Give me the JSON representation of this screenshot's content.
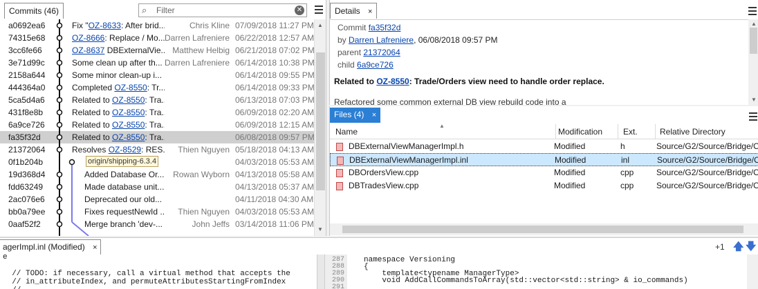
{
  "commits_panel": {
    "tab_label": "Commits (46)",
    "filter_placeholder": "Filter",
    "rows": [
      {
        "hash": "a0692ea6",
        "msg_pre": "Fix \"",
        "msg_link": "OZ-8633",
        "msg_post": ": After brid...",
        "author": "Chris Kline",
        "date": "07/09/2018 11:27 PM"
      },
      {
        "hash": "74315e68",
        "msg_pre": "",
        "msg_link": "OZ-8666",
        "msg_post": ": Replace / Mo...",
        "author": "Darren Lafreniere",
        "date": "06/22/2018 12:57 AM"
      },
      {
        "hash": "3cc6fe66",
        "msg_pre": "",
        "msg_link": "OZ-8637",
        "msg_post": " DBExternalVie...",
        "author": "Matthew Helbig",
        "date": "06/21/2018 07:02 PM"
      },
      {
        "hash": "3e71d99c",
        "msg_pre": "Some clean up after th...",
        "msg_link": "",
        "msg_post": "",
        "author": "Darren Lafreniere",
        "date": "06/14/2018 10:38 PM"
      },
      {
        "hash": "2158a644",
        "msg_pre": "Some minor clean-up i...",
        "msg_link": "",
        "msg_post": "",
        "author": "",
        "date": "06/14/2018 09:55 PM"
      },
      {
        "hash": "444364a0",
        "msg_pre": "Completed ",
        "msg_link": "OZ-8550",
        "msg_post": ": Tr...",
        "author": "",
        "date": "06/14/2018 09:33 PM"
      },
      {
        "hash": "5ca5d4a6",
        "msg_pre": "Related to ",
        "msg_link": "OZ-8550",
        "msg_post": ": Tra...",
        "author": "",
        "date": "06/13/2018 07:03 PM"
      },
      {
        "hash": "431f8e8b",
        "msg_pre": "Related to ",
        "msg_link": "OZ-8550",
        "msg_post": ": Tra...",
        "author": "",
        "date": "06/09/2018 02:20 AM"
      },
      {
        "hash": "6a9ce726",
        "msg_pre": "Related to ",
        "msg_link": "OZ-8550",
        "msg_post": ": Tra...",
        "author": "",
        "date": "06/09/2018 12:15 AM"
      },
      {
        "hash": "fa35f32d",
        "msg_pre": "Related to ",
        "msg_link": "OZ-8550",
        "msg_post": ": Tra...",
        "author": "",
        "date": "06/08/2018 09:57 PM"
      },
      {
        "hash": "21372064",
        "msg_pre": "Resolves ",
        "msg_link": "OZ-8529",
        "msg_post": ": RES...",
        "author": "Thien Nguyen",
        "date": "05/18/2018 04:13 AM"
      },
      {
        "hash": "0f1b204b",
        "msg_pre": "",
        "msg_link": "",
        "msg_post": "",
        "author": "",
        "date": "04/03/2018 05:53 AM",
        "branch": "origin/shipping-6.3.4"
      },
      {
        "hash": "19d368d4",
        "msg_pre": "Added Database Or...",
        "msg_link": "",
        "msg_post": "",
        "author": "Rowan Wyborn",
        "date": "04/13/2018 05:58 AM"
      },
      {
        "hash": "fdd63249",
        "msg_pre": "Made database unit...",
        "msg_link": "",
        "msg_post": "",
        "author": "",
        "date": "04/13/2018 05:37 AM"
      },
      {
        "hash": "2ac076e6",
        "msg_pre": "Deprecated our old...",
        "msg_link": "",
        "msg_post": "",
        "author": "",
        "date": "04/11/2018 04:30 AM"
      },
      {
        "hash": "bb0a79ee",
        "msg_pre": "Fixes requestNewId ...",
        "msg_link": "",
        "msg_post": "",
        "author": "Thien Nguyen",
        "date": "04/03/2018 05:53 AM"
      },
      {
        "hash": "0aaf52f2",
        "msg_pre": "Merge branch 'dev-...",
        "msg_link": "",
        "msg_post": "",
        "author": "John Jeffs",
        "date": "03/14/2018 11:06 PM"
      }
    ],
    "selected_index": 9
  },
  "details_panel": {
    "tab_label": "Details",
    "close_glyph": "×",
    "commit_label": "Commit",
    "commit_hash": "fa35f32d",
    "by_label": "by",
    "author": "Darren Lafreniere",
    "author_date": ", 06/08/2018 09:57 PM",
    "parent_label": "parent",
    "parent_hash": "21372064",
    "child_label": "child",
    "child_hash": "6a9ce726",
    "summary_pre": "Related to ",
    "summary_link": "OZ-8550",
    "summary_post": ": Trade/Orders view need to handle order replace.",
    "body": "Refactored some common external DB view rebuild code into a"
  },
  "files_panel": {
    "tab_label": "Files (4)",
    "close_glyph": "×",
    "columns": {
      "name": "Name",
      "modification": "Modification",
      "ext": "Ext.",
      "dir": "Relative Directory"
    },
    "rows": [
      {
        "name": "DBExternalViewManagerImpl.h",
        "mod": "Modified",
        "ext": "h",
        "dir": "Source/G2/Source/Bridge/O"
      },
      {
        "name": "DBExternalViewManagerImpl.inl",
        "mod": "Modified",
        "ext": "inl",
        "dir": "Source/G2/Source/Bridge/O"
      },
      {
        "name": "DBOrdersView.cpp",
        "mod": "Modified",
        "ext": "cpp",
        "dir": "Source/G2/Source/Bridge/O"
      },
      {
        "name": "DBTradesView.cpp",
        "mod": "Modified",
        "ext": "cpp",
        "dir": "Source/G2/Source/Bridge/O"
      }
    ],
    "selected_index": 1
  },
  "diff_panel": {
    "tab_label": "agerImpl.inl (Modified)",
    "close_glyph": "×",
    "change_counter": "+1",
    "left_lines": [
      "e",
      "",
      "  // TODO: if necessary, call a virtual method that accepts the",
      "  // in_attributeIndex, and permuteAttributesStartingFromIndex",
      "  // ..."
    ],
    "right_line_numbers": [
      "287",
      "288",
      "289",
      "290",
      "291"
    ],
    "right_lines": [
      "",
      "namespace Versioning",
      "{",
      "    template<typename ManagerType>",
      "    void AddCallCommandsToArray(std::vector<std::string> & io_commands)"
    ]
  },
  "colors": {
    "accent": "#2b7fd4",
    "link": "#0645ad",
    "selection": "#cce8ff",
    "graph_line": "#7b7be8"
  }
}
